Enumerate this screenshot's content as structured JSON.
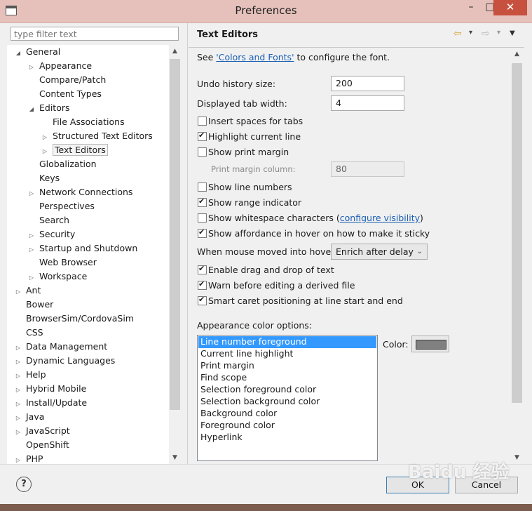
{
  "window": {
    "title": "Preferences",
    "min": "–",
    "max": "□",
    "close": "✕"
  },
  "filter": {
    "placeholder": "type filter text"
  },
  "tree": [
    {
      "label": "General",
      "twisty": "◢",
      "indent": 0
    },
    {
      "label": "Appearance",
      "twisty": "▷",
      "indent": 1
    },
    {
      "label": "Compare/Patch",
      "twisty": "",
      "indent": 1
    },
    {
      "label": "Content Types",
      "twisty": "",
      "indent": 1
    },
    {
      "label": "Editors",
      "twisty": "◢",
      "indent": 1
    },
    {
      "label": "File Associations",
      "twisty": "",
      "indent": 2
    },
    {
      "label": "Structured Text Editors",
      "twisty": "▷",
      "indent": 2
    },
    {
      "label": "Text Editors",
      "twisty": "▷",
      "indent": 2,
      "selected": true
    },
    {
      "label": "Globalization",
      "twisty": "",
      "indent": 1
    },
    {
      "label": "Keys",
      "twisty": "",
      "indent": 1
    },
    {
      "label": "Network Connections",
      "twisty": "▷",
      "indent": 1
    },
    {
      "label": "Perspectives",
      "twisty": "",
      "indent": 1
    },
    {
      "label": "Search",
      "twisty": "",
      "indent": 1
    },
    {
      "label": "Security",
      "twisty": "▷",
      "indent": 1
    },
    {
      "label": "Startup and Shutdown",
      "twisty": "▷",
      "indent": 1
    },
    {
      "label": "Web Browser",
      "twisty": "",
      "indent": 1
    },
    {
      "label": "Workspace",
      "twisty": "▷",
      "indent": 1
    },
    {
      "label": "Ant",
      "twisty": "▷",
      "indent": 0
    },
    {
      "label": "Bower",
      "twisty": "",
      "indent": 0
    },
    {
      "label": "BrowserSim/CordovaSim",
      "twisty": "",
      "indent": 0
    },
    {
      "label": "CSS",
      "twisty": "",
      "indent": 0
    },
    {
      "label": "Data Management",
      "twisty": "▷",
      "indent": 0
    },
    {
      "label": "Dynamic Languages",
      "twisty": "▷",
      "indent": 0
    },
    {
      "label": "Help",
      "twisty": "▷",
      "indent": 0
    },
    {
      "label": "Hybrid Mobile",
      "twisty": "▷",
      "indent": 0
    },
    {
      "label": "Install/Update",
      "twisty": "▷",
      "indent": 0
    },
    {
      "label": "Java",
      "twisty": "▷",
      "indent": 0
    },
    {
      "label": "JavaScript",
      "twisty": "▷",
      "indent": 0
    },
    {
      "label": "OpenShift",
      "twisty": "",
      "indent": 0
    },
    {
      "label": "PHP",
      "twisty": "▷",
      "indent": 0
    }
  ],
  "page": {
    "title": "Text Editors",
    "nav": {
      "back": "⇦",
      "back_menu": "▾",
      "forward": "⇨",
      "forward_menu": "▾",
      "view_menu": "▼"
    },
    "see_prefix": "See ",
    "see_link": "'Colors and Fonts'",
    "see_suffix": " to configure the font.",
    "undo_label": "Undo history size:",
    "undo_value": "200",
    "tab_label": "Displayed tab width:",
    "tab_value": "4",
    "insert_spaces": "Insert spaces for tabs",
    "highlight_line": "Highlight current line",
    "show_print_margin": "Show print margin",
    "print_margin_label": "Print margin column:",
    "print_margin_value": "80",
    "show_line_numbers": "Show line numbers",
    "show_range": "Show range indicator",
    "show_whitespace": "Show whitespace characters (",
    "configure_visibility": "configure visibility",
    "close_paren": ")",
    "show_affordance": "Show affordance in hover on how to make it sticky",
    "hover_label": "When mouse moved into hover:",
    "hover_value": "Enrich after delay",
    "enable_dnd": "Enable drag and drop of text",
    "warn_derived": "Warn before editing a derived file",
    "smart_caret": "Smart caret positioning at line start and end",
    "appearance_label": "Appearance color options:",
    "color_label": "Color:",
    "color_value": "#808080",
    "color_options": [
      "Line number foreground",
      "Current line highlight",
      "Print margin",
      "Find scope",
      "Selection foreground color",
      "Selection background color",
      "Background color",
      "Foreground color",
      "Hyperlink"
    ]
  },
  "buttons": {
    "help": "?",
    "ok": "OK",
    "cancel": "Cancel"
  },
  "watermark": "Baidu 经验"
}
